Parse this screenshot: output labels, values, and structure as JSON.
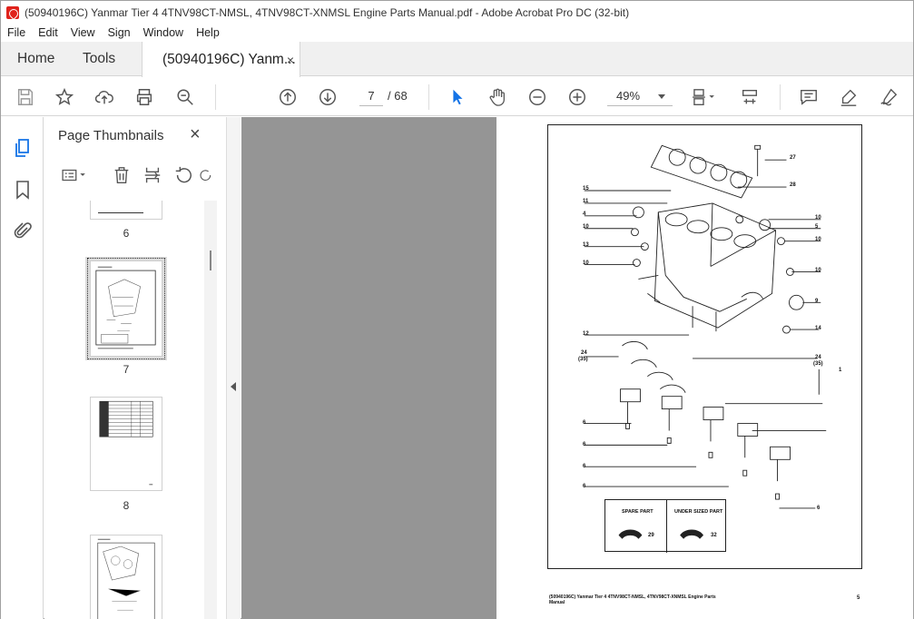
{
  "window": {
    "title": "(50940196C) Yanmar Tier 4 4TNV98CT-NMSL, 4TNV98CT-XNMSL Engine Parts Manual.pdf - Adobe Acrobat Pro DC (32-bit)"
  },
  "menu": [
    "File",
    "Edit",
    "View",
    "Sign",
    "Window",
    "Help"
  ],
  "tabs": {
    "home": "Home",
    "tools": "Tools",
    "doc": "(50940196C) Yanm...",
    "close": "×"
  },
  "toolbar": {
    "page_current": "7",
    "page_total": "/ 68",
    "zoom": "49%"
  },
  "panel": {
    "title": "Page Thumbnails",
    "close": "×",
    "thumbnails": [
      {
        "label": "6"
      },
      {
        "label": "7"
      },
      {
        "label": "8"
      },
      {
        "label": ""
      }
    ]
  },
  "document": {
    "footer": "(50940196C) Yanmar Tier 4 4TNV98CT-NMSL, 4TNV98CT-XNMSL Engine Parts Manual",
    "page_number": "5",
    "legend": {
      "spare_part": "SPARE PART",
      "spare_num": "29",
      "under_sized": "UNDER SIZED PART",
      "under_num": "32"
    },
    "callouts_left": [
      "15",
      "11",
      "4",
      "10",
      "13",
      "10",
      "12",
      "24",
      "(35)",
      "6",
      "6",
      "6",
      "6"
    ],
    "callouts_right": [
      "27",
      "28",
      "10",
      "5",
      "10",
      "10",
      "9",
      "14",
      "24",
      "(35)",
      "1",
      "6"
    ]
  },
  "colors": {
    "accent": "#1473e6",
    "viewer_bg": "#959595",
    "tabbar_bg": "#f0f0f0"
  }
}
